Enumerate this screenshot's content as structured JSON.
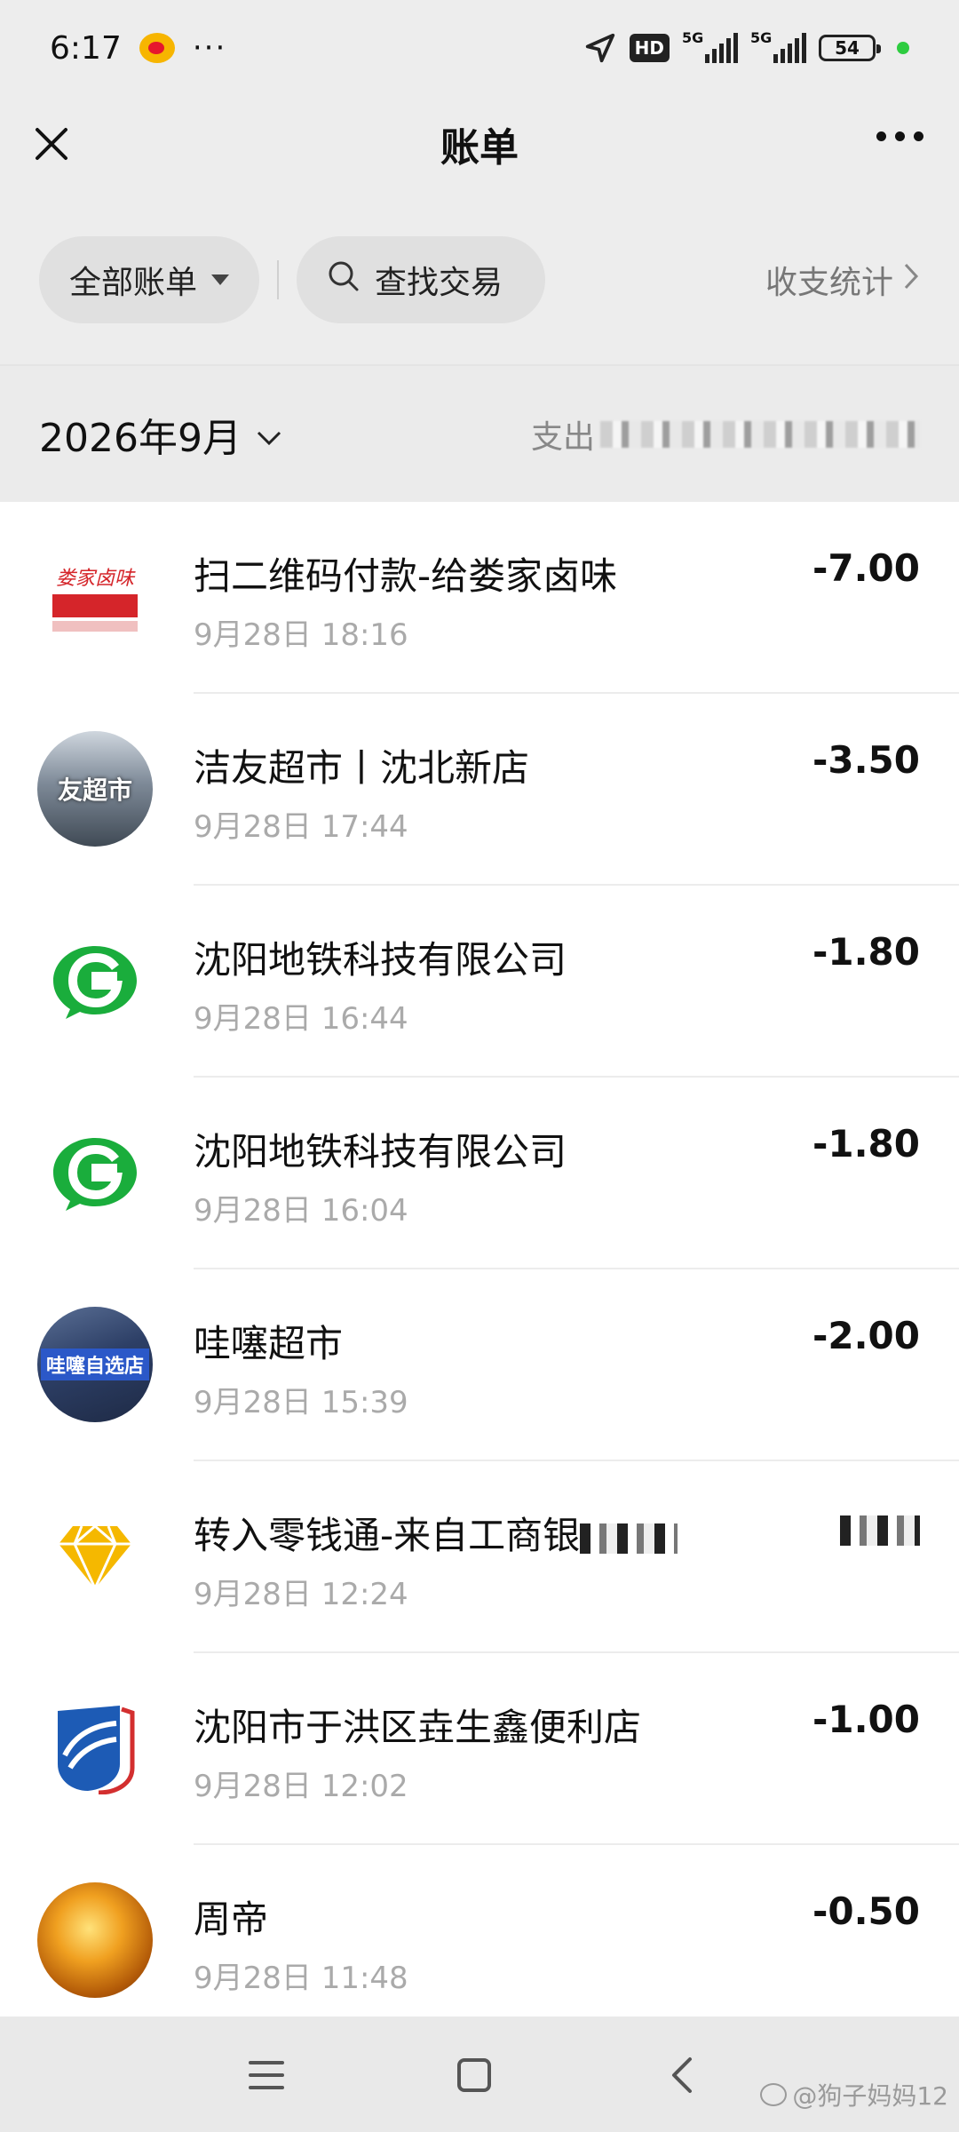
{
  "status_bar": {
    "time": "6:17",
    "more": "···",
    "hd": "HD",
    "net1": "5G",
    "net2": "5G",
    "battery": "54"
  },
  "header": {
    "title": "账单"
  },
  "filters": {
    "all_bills": "全部账单",
    "search": "查找交易",
    "stats": "收支统计"
  },
  "month": {
    "label": "2026年9月",
    "summary_prefix": "支出"
  },
  "transactions": [
    {
      "name": "扫二维码付款-给娄家卤味",
      "time": "9月28日 18:16",
      "amount": "-7.00",
      "avatar": "lou-jia-lu-wei-logo"
    },
    {
      "name": "洁友超市丨沈北新店",
      "time": "9月28日 17:44",
      "amount": "-3.50",
      "avatar": "supermarket-photo",
      "avatar_text": "友超市"
    },
    {
      "name": "沈阳地铁科技有限公司",
      "time": "9月28日 16:44",
      "amount": "-1.80",
      "avatar": "metro-green-g-logo"
    },
    {
      "name": "沈阳地铁科技有限公司",
      "time": "9月28日 16:04",
      "amount": "-1.80",
      "avatar": "metro-green-g-logo"
    },
    {
      "name": "哇噻超市",
      "time": "9月28日 15:39",
      "amount": "-2.00",
      "avatar": "store-photo",
      "avatar_text": "哇噻自选店"
    },
    {
      "name": "转入零钱通-来自工商银",
      "time": "9月28日 12:24",
      "amount": "",
      "avatar": "diamond-logo"
    },
    {
      "name": "沈阳市于洪区垚生鑫便利店",
      "time": "9月28日 12:02",
      "amount": "-1.00",
      "avatar": "blue-swoosh-logo"
    },
    {
      "name": "周帝",
      "time": "9月28日 11:48",
      "amount": "-0.50",
      "avatar": "autumn-tree-photo"
    }
  ],
  "watermark": "@狗子妈妈12",
  "colors": {
    "background": "#ededed",
    "list_bg": "#ffffff",
    "metro_green": "#1aad3c",
    "diamond_gold": "#f5b800",
    "brand_blue": "#1d5bb5"
  }
}
